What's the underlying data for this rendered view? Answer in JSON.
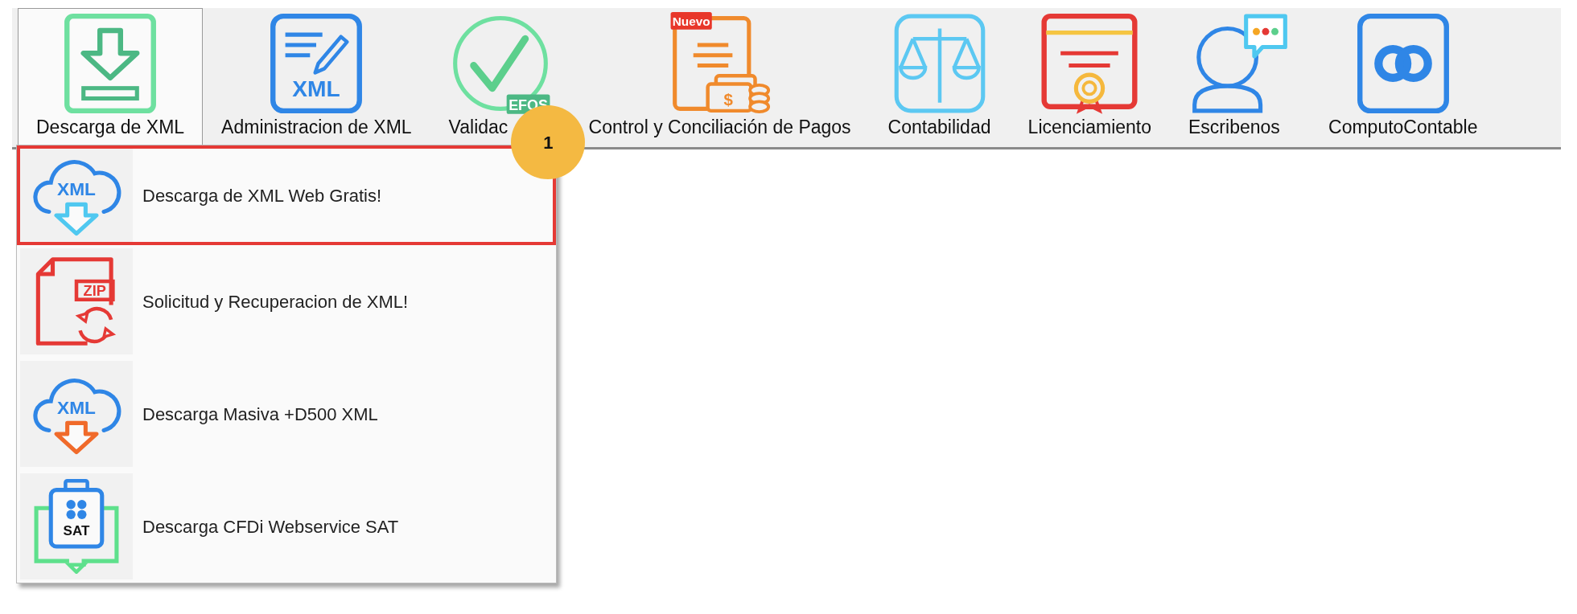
{
  "toolbar": {
    "items": [
      {
        "label": "Descarga de XML",
        "kind": "download",
        "selected": true
      },
      {
        "label": "Administracion de XML",
        "kind": "xml-edit",
        "icon_text": "XML",
        "selected": false
      },
      {
        "label": "Validac",
        "kind": "check-circle",
        "tag": "EFOS",
        "callout": "1",
        "selected": false
      },
      {
        "label": "Control y Conciliación de Pagos",
        "kind": "payments",
        "tag": "Nuevo",
        "icon_text": "$",
        "selected": false
      },
      {
        "label": "Contabilidad",
        "kind": "scale",
        "selected": false
      },
      {
        "label": "Licenciamiento",
        "kind": "certificate",
        "selected": false
      },
      {
        "label": "Escribenos",
        "kind": "chat-person",
        "selected": false
      },
      {
        "label": "ComputoContable",
        "kind": "link",
        "selected": false
      }
    ]
  },
  "menu": {
    "items": [
      {
        "label": "Descarga de XML Web Gratis!",
        "kind": "cloud",
        "icon_text": "XML",
        "color": "#4fc8f0",
        "highlighted": true
      },
      {
        "label": "Solicitud y Recuperacion de XML!",
        "kind": "zip",
        "icon_text": "ZIP",
        "highlighted": false
      },
      {
        "label": "Descarga Masiva +D500 XML",
        "kind": "cloud",
        "icon_text": "XML",
        "color": "#f06a2a",
        "highlighted": false
      },
      {
        "label": "Descarga CFDi Webservice SAT",
        "kind": "sat",
        "icon_text": "SAT",
        "highlighted": false
      }
    ]
  }
}
